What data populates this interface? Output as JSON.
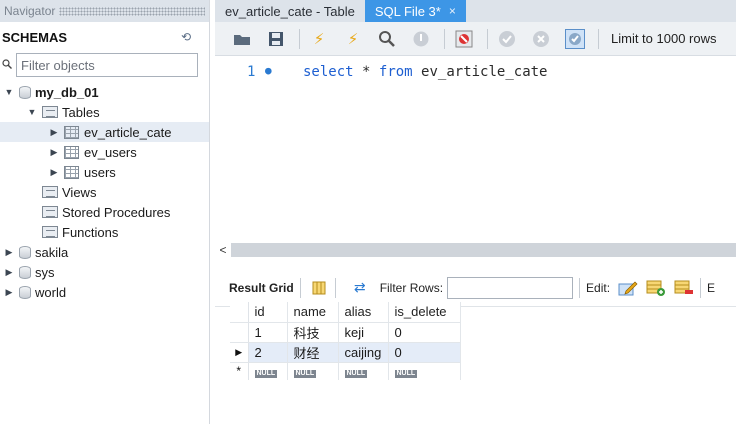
{
  "navigator": {
    "title": "Navigator",
    "schemas_label": "SCHEMAS",
    "filter_placeholder": "Filter objects",
    "tree": {
      "db": "my_db_01",
      "tables_folder": "Tables",
      "tables": [
        "ev_article_cate",
        "ev_users",
        "users"
      ],
      "folders": [
        "Views",
        "Stored Procedures",
        "Functions"
      ],
      "other_dbs": [
        "sakila",
        "sys",
        "world"
      ]
    }
  },
  "tabs": [
    {
      "label": "ev_article_cate - Table"
    },
    {
      "label": "SQL File 3*",
      "close": "×"
    }
  ],
  "toolbar": {
    "limit_label": "Limit to 1000 rows"
  },
  "editor": {
    "line_number": "1",
    "line_dot": "●",
    "keyword_select": "select",
    "star": "*",
    "keyword_from": "from",
    "table": "ev_article_cate"
  },
  "results_toolbar": {
    "result_grid_label": "Result Grid",
    "filter_rows_label": "Filter Rows:",
    "edit_label": "Edit:",
    "export_label": "E"
  },
  "grid": {
    "columns": [
      "id",
      "name",
      "alias",
      "is_delete"
    ],
    "rows": [
      [
        "1",
        "科技",
        "keji",
        "0"
      ],
      [
        "2",
        "财经",
        "caijing",
        "0"
      ]
    ],
    "new_row_marker": "*",
    "null_label": "NULL",
    "selected_row_marker": "▶"
  },
  "scrollbar": {
    "left_arrow": "<"
  }
}
